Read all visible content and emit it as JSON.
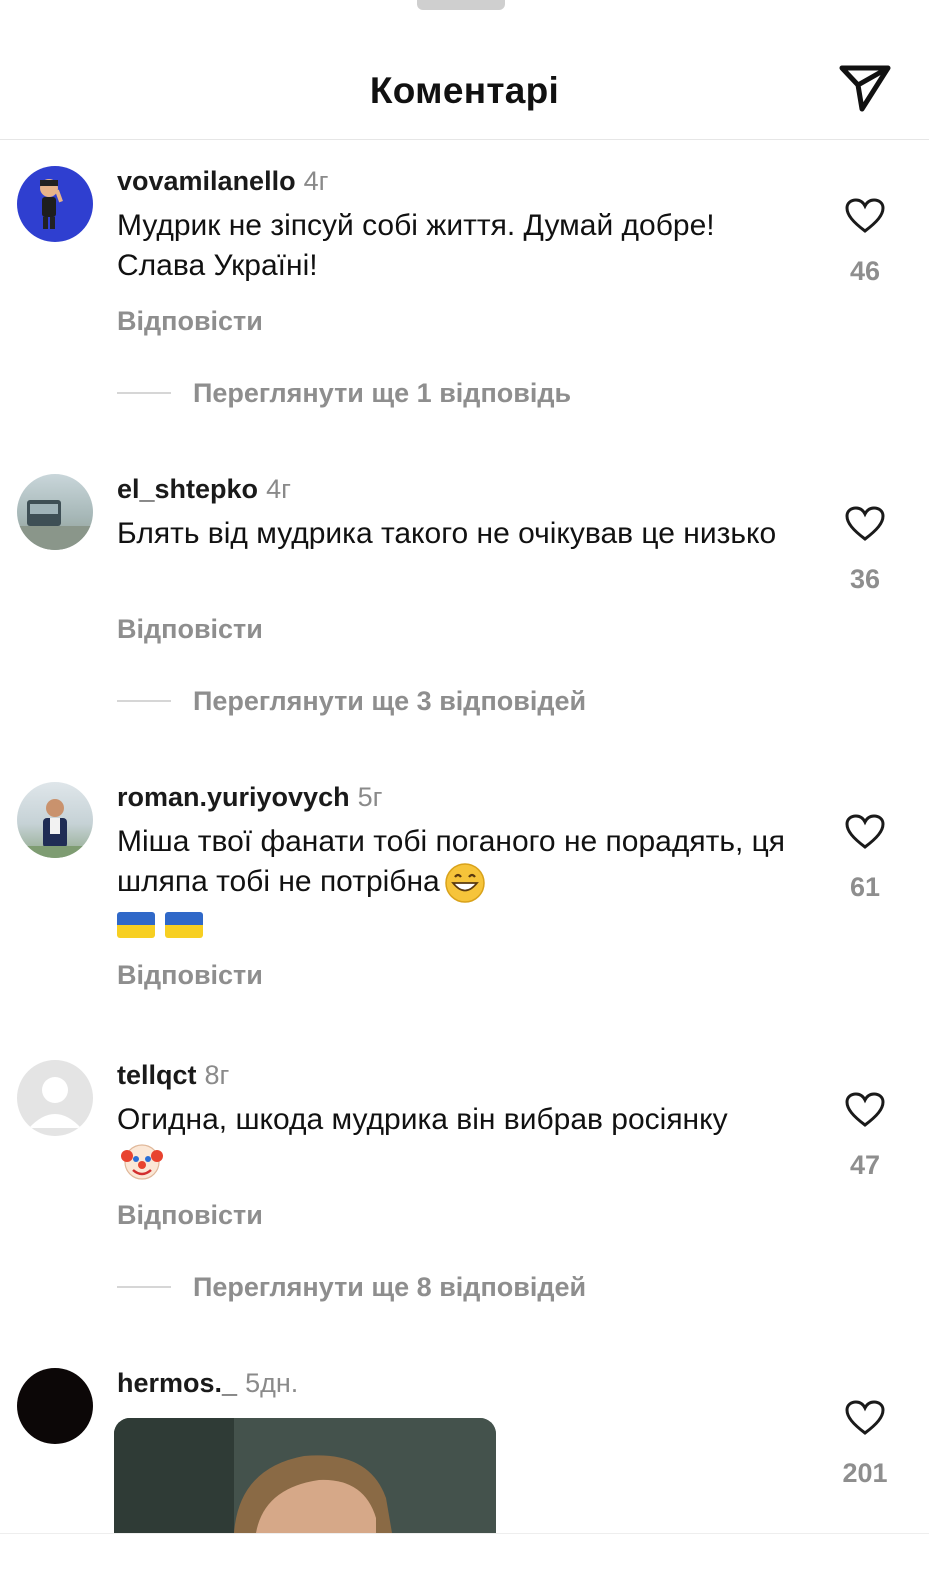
{
  "header": {
    "title": "Коментарі"
  },
  "comments": [
    {
      "username": "vovamilanello",
      "time": "4г",
      "text": "Мудрик не зіпсуй собі життя. Думай добре! Слава Україні!",
      "reply_label": "Відповісти",
      "likes": "46",
      "view_replies": "Переглянути ще 1 відповідь"
    },
    {
      "username": "el_shtepko",
      "time": "4г",
      "text": "Блять від мудрика такого не очікував це низько",
      "reply_label": "Відповісти",
      "likes": "36",
      "view_replies": "Переглянути ще 3 відповідей"
    },
    {
      "username": "roman.yuriyovych",
      "time": "5г",
      "text": "Міша твої фанати тобі поганого не порадять, ця шляпа тобі не потрібна",
      "reply_label": "Відповісти",
      "likes": "61"
    },
    {
      "username": "tellqct",
      "time": "8г",
      "text": "Огидна, шкода мудрика він вибрав росіянку",
      "reply_label": "Відповісти",
      "likes": "47",
      "view_replies": "Переглянути ще 8 відповідей"
    },
    {
      "username": "hermos._",
      "time": "5дн.",
      "likes": "201"
    }
  ],
  "icons": {
    "share": "paper-plane-icon",
    "like": "heart-outline-icon",
    "smile": "grinning-face-emoji",
    "clown": "clown-face-emoji",
    "flag": "ukraine-flag-emoji"
  },
  "colors": {
    "muted": "#8e8e8e",
    "text": "#111111",
    "flag_blue": "#2f68c8",
    "flag_yellow": "#f7cf22"
  }
}
